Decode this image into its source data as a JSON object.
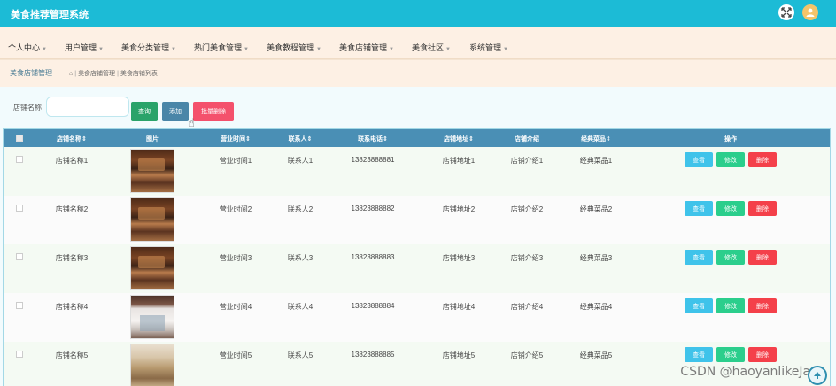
{
  "app": {
    "title": "美食推荐管理系统"
  },
  "topbar": {
    "fullscreen_icon": "fullscreen-icon",
    "avatar_icon": "user-avatar-icon",
    "avatar_color": "#f5c46a",
    "bg_color": "#1cbbd6"
  },
  "nav": {
    "items": [
      {
        "label": "个人中心"
      },
      {
        "label": "用户管理"
      },
      {
        "label": "美食分类管理"
      },
      {
        "label": "热门美食管理"
      },
      {
        "label": "美食教程管理"
      },
      {
        "label": "美食店铺管理"
      },
      {
        "label": "美食社区"
      },
      {
        "label": "系统管理"
      }
    ]
  },
  "breadcrumb": {
    "section": "美食店铺管理",
    "path": [
      "美食店铺管理",
      "美食店铺列表"
    ]
  },
  "search": {
    "label": "店铺名称",
    "value": "",
    "search_button": "查询",
    "add_button": "添加",
    "bulk_delete_button": "批量删除"
  },
  "table": {
    "columns": [
      "店铺名称",
      "图片",
      "营业时间",
      "联系人",
      "联系电话",
      "店铺地址",
      "店铺介绍",
      "经典菜品",
      "操作"
    ],
    "sort_columns": [
      "店铺名称",
      "营业时间",
      "联系人",
      "联系电话",
      "店铺地址",
      "经典菜品"
    ],
    "sort_marker": "⇕",
    "action_labels": {
      "view": "查看",
      "edit": "修改",
      "delete": "删除"
    },
    "rows": [
      {
        "name": "店铺名称1",
        "hours": "营业时间1",
        "contact": "联系人1",
        "phone": "13823888881",
        "address": "店铺地址1",
        "intro": "店铺介绍1",
        "dish": "经典菜品1"
      },
      {
        "name": "店铺名称2",
        "hours": "营业时间2",
        "contact": "联系人2",
        "phone": "13823888882",
        "address": "店铺地址2",
        "intro": "店铺介绍2",
        "dish": "经典菜品2"
      },
      {
        "name": "店铺名称3",
        "hours": "营业时间3",
        "contact": "联系人3",
        "phone": "13823888883",
        "address": "店铺地址3",
        "intro": "店铺介绍3",
        "dish": "经典菜品3"
      },
      {
        "name": "店铺名称4",
        "hours": "营业时间4",
        "contact": "联系人4",
        "phone": "13823888884",
        "address": "店铺地址4",
        "intro": "店铺介绍4",
        "dish": "经典菜品4"
      },
      {
        "name": "店铺名称5",
        "hours": "营业时间5",
        "contact": "联系人5",
        "phone": "13823888885",
        "address": "店铺地址5",
        "intro": "店铺介绍5",
        "dish": "经典菜品5"
      }
    ]
  },
  "watermark": "CSDN @haoyanlikeJava",
  "colors": {
    "view": "#3fc3ea",
    "edit": "#2bce8c",
    "delete": "#f4404a",
    "header": "#4a8fb5"
  }
}
